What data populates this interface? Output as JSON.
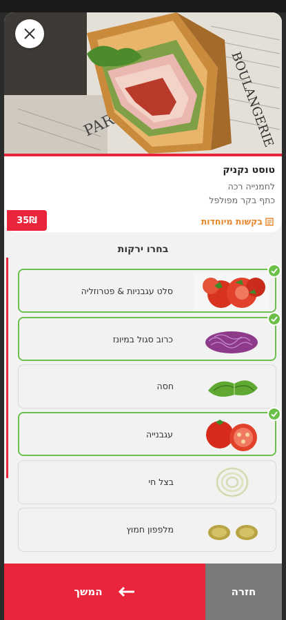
{
  "product": {
    "title": "טוסט נקניק",
    "line1": "לחמנייה רכה",
    "line2": "כתף בקר מפולפל",
    "special_requests": "בקשות מיוחדות",
    "price": "35₪"
  },
  "section": {
    "title": "בחרו ירקות"
  },
  "options": [
    {
      "label": "סלט עגבניות & פטרוזליה",
      "selected": true,
      "icon": "tomato-salad-icon"
    },
    {
      "label": "כרוב סגול במיונז",
      "selected": true,
      "icon": "purple-cabbage-icon"
    },
    {
      "label": "חסה",
      "selected": false,
      "icon": "lettuce-icon"
    },
    {
      "label": "עגבנייה",
      "selected": true,
      "icon": "tomato-icon"
    },
    {
      "label": "בצל חי",
      "selected": false,
      "icon": "onion-icon"
    },
    {
      "label": "מלפפון חמוץ",
      "selected": false,
      "icon": "pickle-icon"
    }
  ],
  "footer": {
    "continue_label": "המשך",
    "back_label": "חזרה"
  },
  "colors": {
    "accent": "#e8253a",
    "selected_border": "#6cc04a",
    "special_requests": "#e8862a",
    "back_button": "#7a7a7a"
  }
}
